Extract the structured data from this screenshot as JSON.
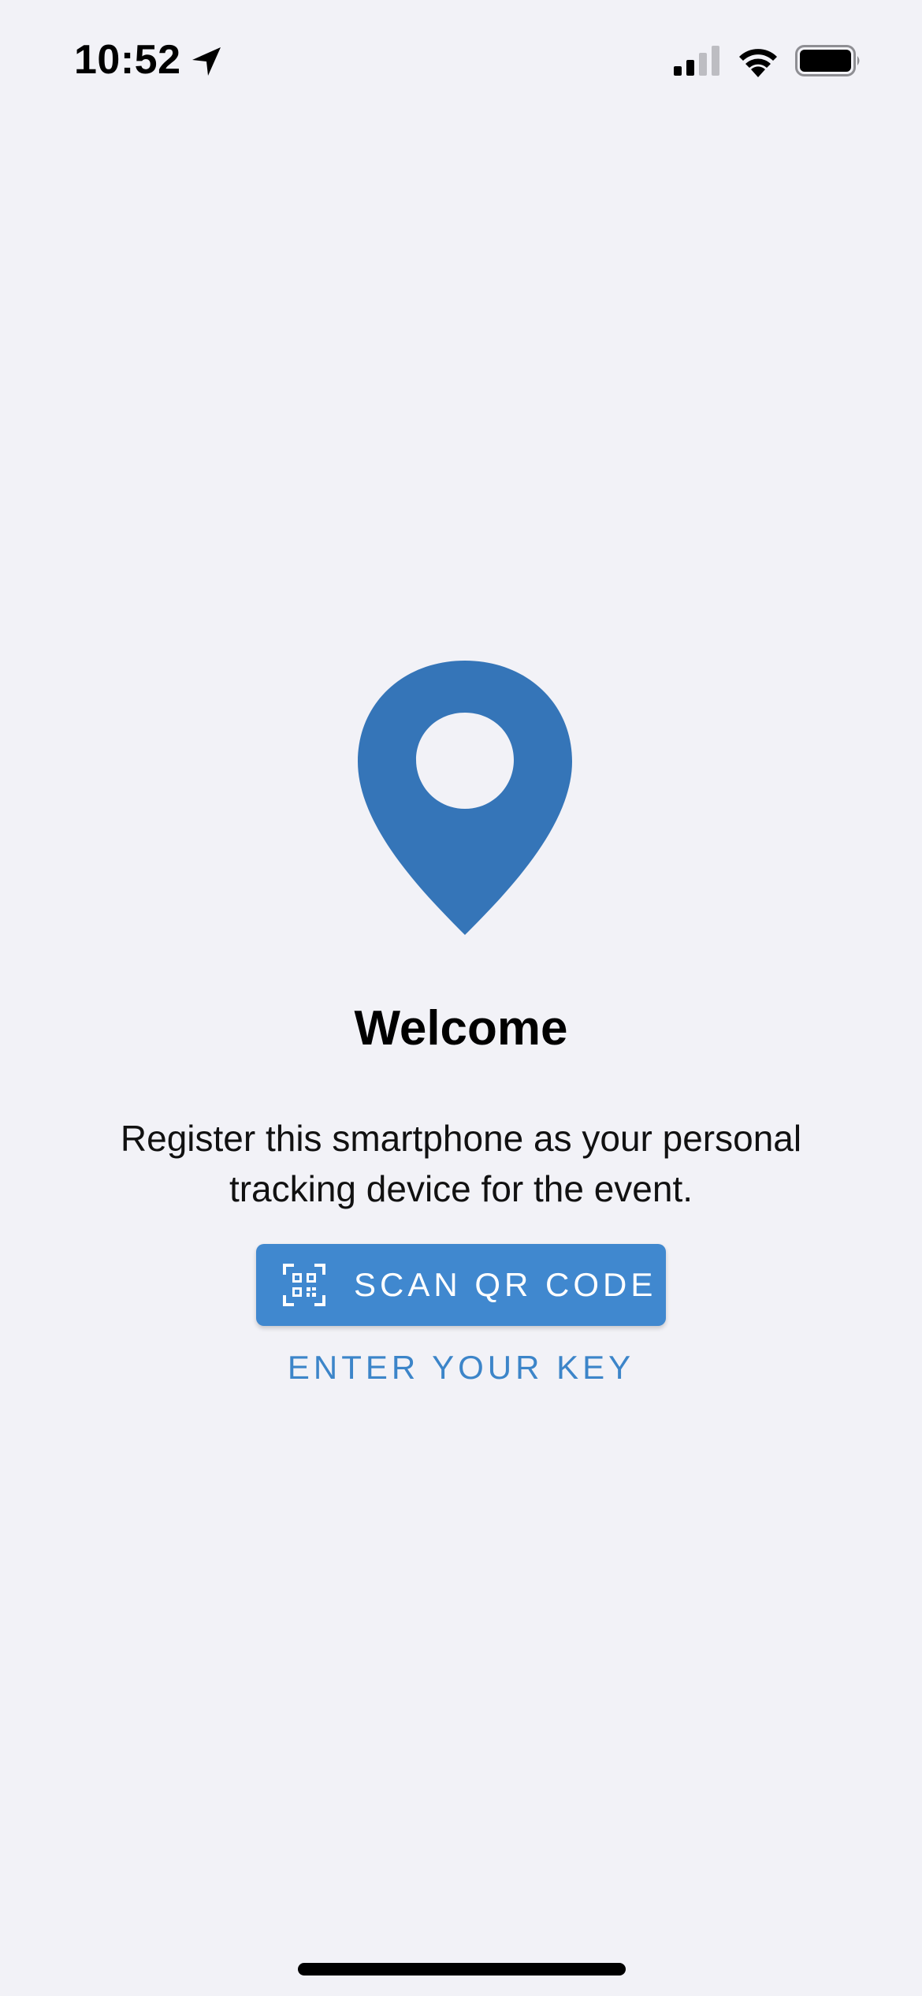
{
  "status_bar": {
    "time": "10:52",
    "icons": [
      "location-arrow-icon",
      "cellular-signal-icon",
      "wifi-icon",
      "battery-icon"
    ]
  },
  "main": {
    "icon": "location-pin-icon",
    "title": "Welcome",
    "description": "Register this smartphone as your personal tracking device for the event.",
    "scan_button": {
      "label": "SCAN QR CODE",
      "icon": "qr-code-scan-icon"
    },
    "enter_key_label": "ENTER YOUR KEY"
  },
  "colors": {
    "accent": "#4088cf",
    "pin": "#3575b8",
    "background": "#f2f2f7"
  }
}
